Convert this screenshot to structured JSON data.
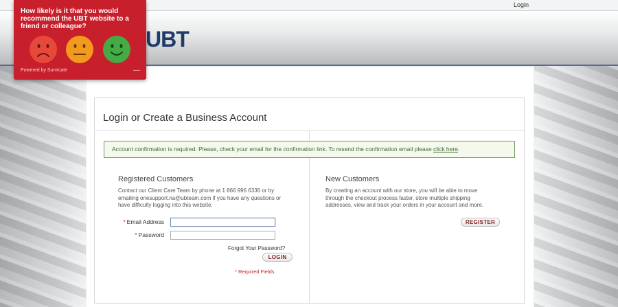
{
  "topbar": {
    "login_link": "Login"
  },
  "header": {
    "logo_text": "UBT"
  },
  "survey": {
    "question": "How likely is it that you would recommend the UBT website to a friend or colleague?",
    "powered_by": "Powered by Survicate",
    "minimize_glyph": "—",
    "faces": [
      {
        "name": "sad-face-icon",
        "color": "#e8483a"
      },
      {
        "name": "neutral-face-icon",
        "color": "#f39a1e"
      },
      {
        "name": "happy-face-icon",
        "color": "#45ab45"
      }
    ]
  },
  "page": {
    "title": "Login or Create a Business Account",
    "notice_text": "Account confirmation is required. Please, check your email for the confirmation link. To resend the confirmation email please ",
    "notice_link": "click here",
    "notice_end": "."
  },
  "registered": {
    "heading": "Registered Customers",
    "description": "Contact our Client Care Team by phone at 1 866 996 6336 or by emailing onesupport.na@ubteam.com if you have any questions or have difficulty logging into this website.",
    "email_label": "Email Address",
    "password_label": "Password",
    "required_mark": "*",
    "forgot_link": "Forgot Your Password?",
    "login_button": "LOGIN",
    "required_note": "* Required Fields"
  },
  "new_customers": {
    "heading": "New Customers",
    "description": "By creating an account with our store, you will be able to move through the checkout process faster, store multiple shipping addresses, view and track your orders in your account and more.",
    "register_button": "REGISTER"
  },
  "colors": {
    "brand_red": "#c71f2b",
    "notice_border": "#6c9a58",
    "logo_navy": "#1f3b6a"
  }
}
